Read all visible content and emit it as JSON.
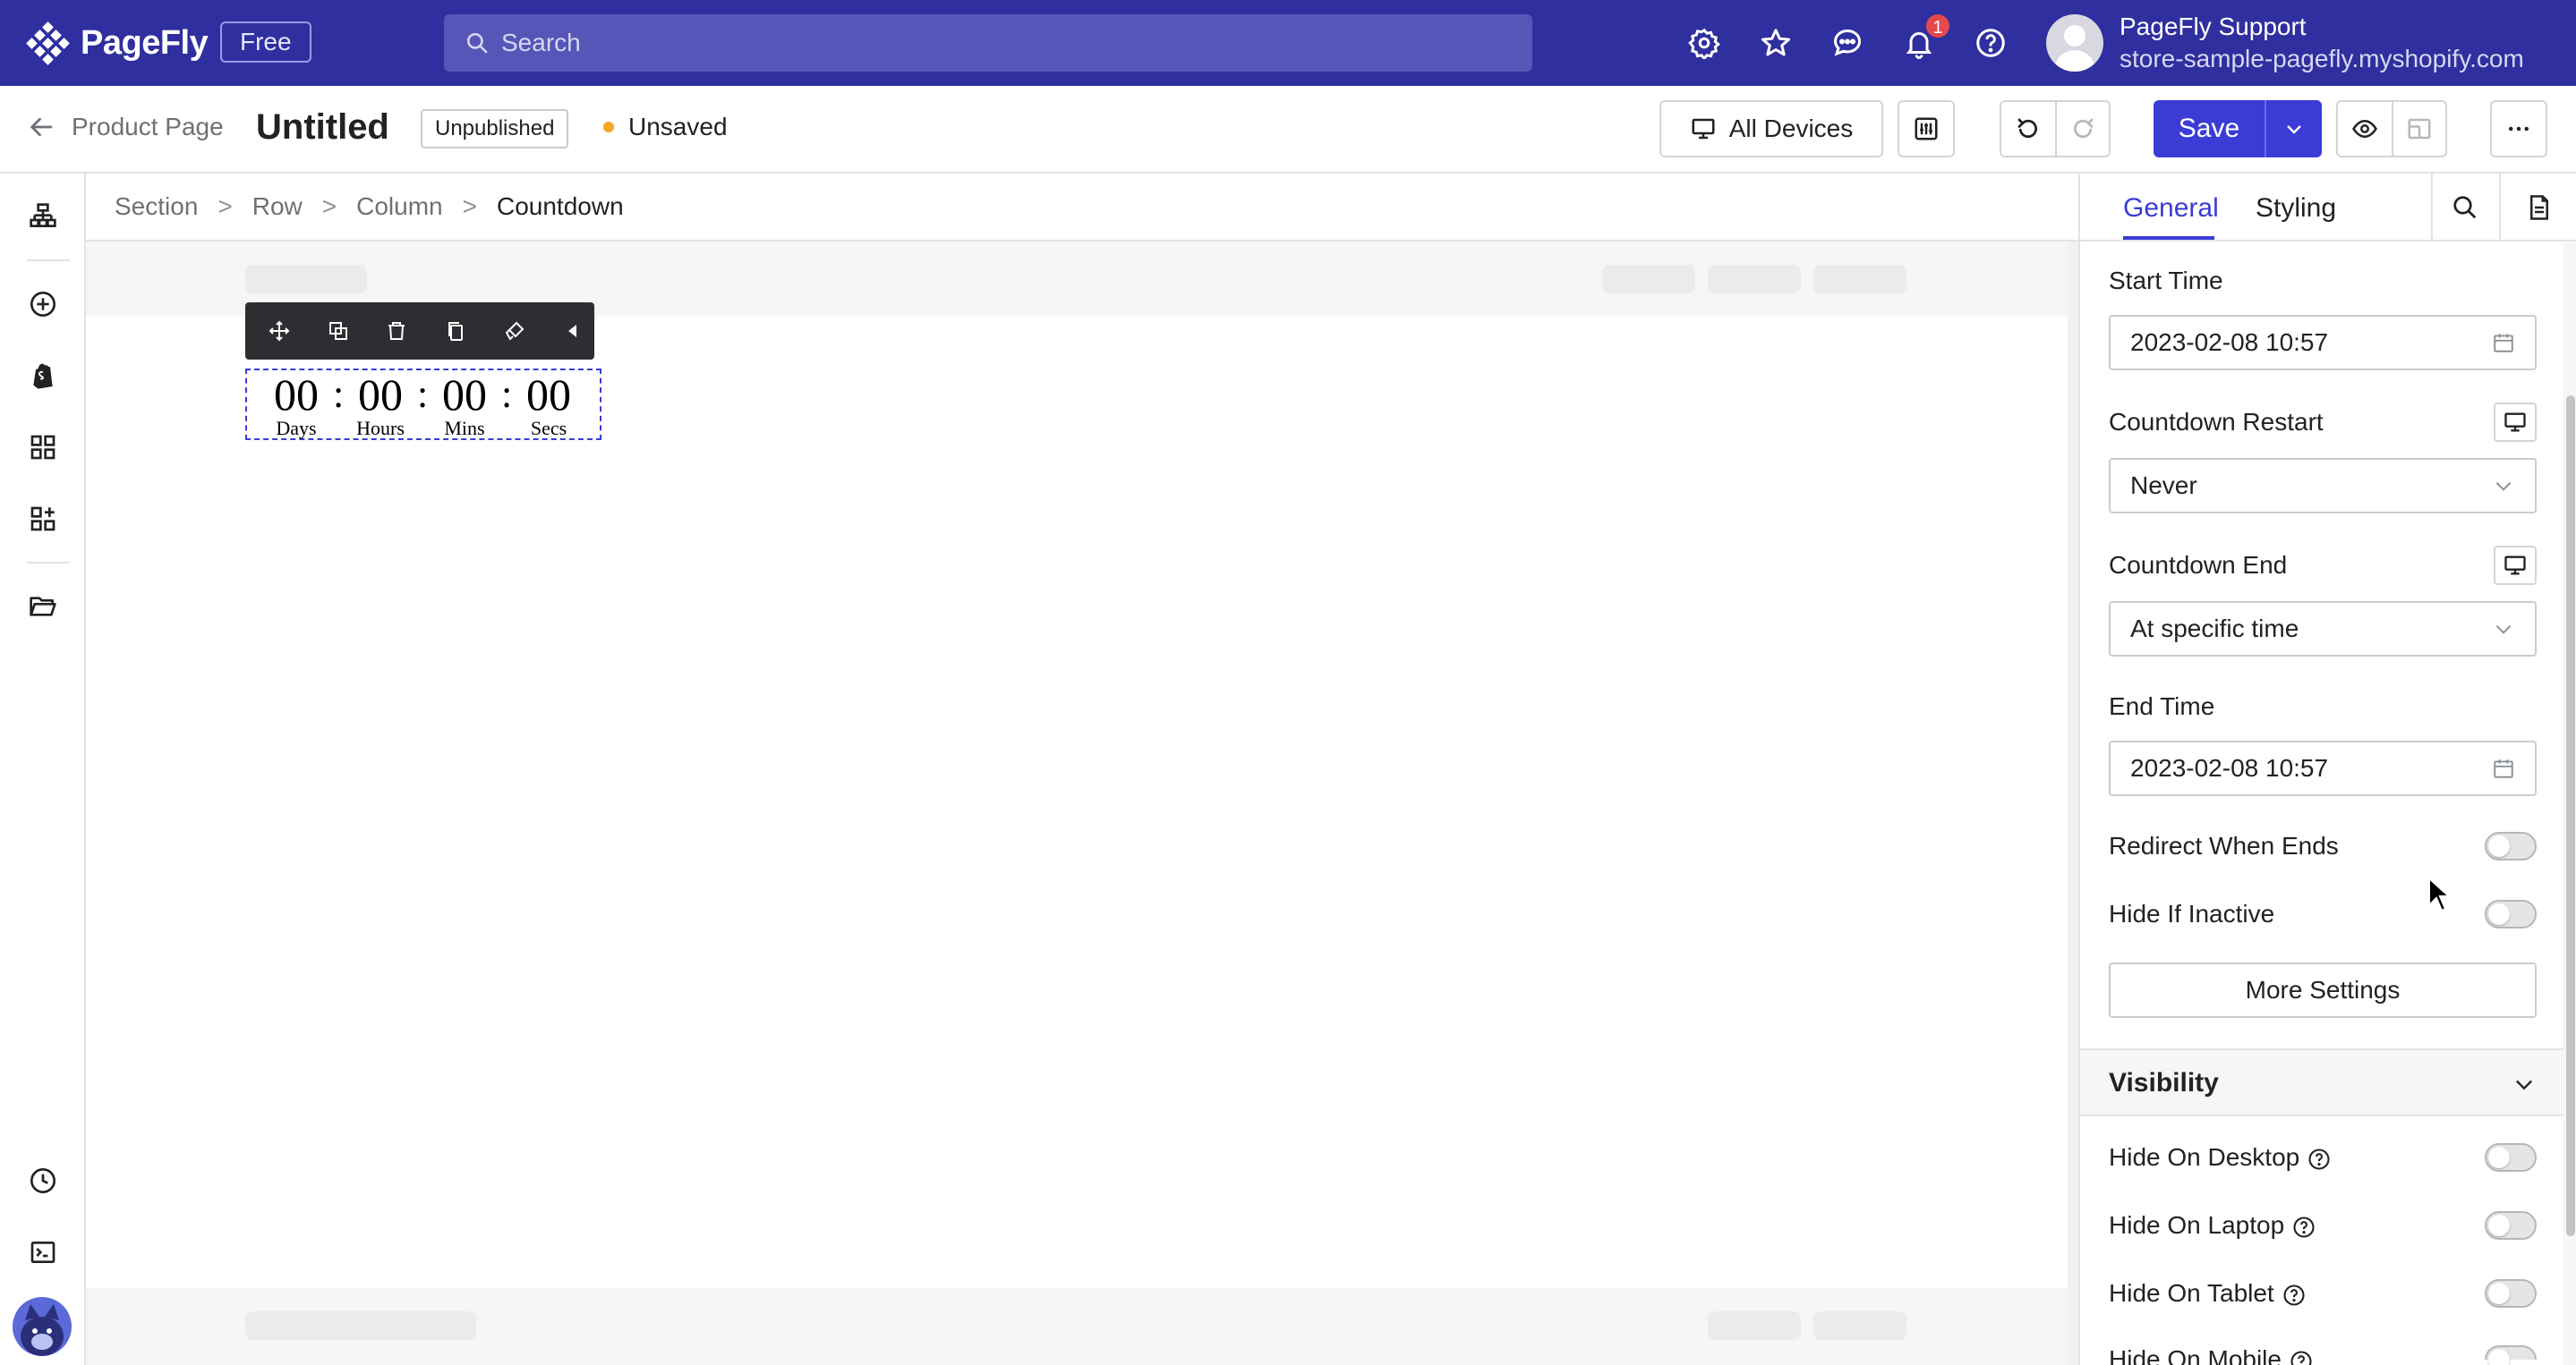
{
  "app": {
    "logo_text": "PageFly",
    "plan_badge": "Free",
    "search_placeholder": "Search",
    "notification_count": "1",
    "user_name": "PageFly Support",
    "user_store": "store-sample-pagefly.myshopify.com",
    "accent_color": "#2f2f9f"
  },
  "editor": {
    "back_label": "Product Page",
    "page_title": "Untitled",
    "status_badge": "Unpublished",
    "save_status": "Unsaved",
    "devices_label": "All Devices",
    "save_label": "Save",
    "primary_color": "#3b3bd6"
  },
  "breadcrumb": [
    "Section",
    "Row",
    "Column",
    "Countdown"
  ],
  "countdown": {
    "days": "00",
    "hours": "00",
    "mins": "00",
    "secs": "00",
    "separator": ":",
    "labels": {
      "days": "Days",
      "hours": "Hours",
      "mins": "Mins",
      "secs": "Secs"
    }
  },
  "toolbar_icons": [
    "move-icon",
    "duplicate-icon",
    "delete-icon",
    "copy-icon",
    "style-brush-icon",
    "collapse-left-icon"
  ],
  "panel": {
    "tabs": [
      "General",
      "Styling"
    ],
    "active_tab": "General",
    "start_time_label": "Start Time",
    "start_time_value": "2023-02-08 10:57",
    "restart_label": "Countdown Restart",
    "restart_value": "Never",
    "end_label": "Countdown End",
    "end_value": "At specific time",
    "end_time_label": "End Time",
    "end_time_value": "2023-02-08 10:57",
    "redirect_label": "Redirect When Ends",
    "redirect_enabled": false,
    "hide_inactive_label": "Hide If Inactive",
    "hide_inactive_enabled": false,
    "more_settings_label": "More Settings",
    "visibility_title": "Visibility",
    "visibility": [
      {
        "label": "Hide On Desktop",
        "enabled": false
      },
      {
        "label": "Hide On Laptop",
        "enabled": false
      },
      {
        "label": "Hide On Tablet",
        "enabled": false
      },
      {
        "label": "Hide On Mobile",
        "enabled": false
      }
    ]
  }
}
